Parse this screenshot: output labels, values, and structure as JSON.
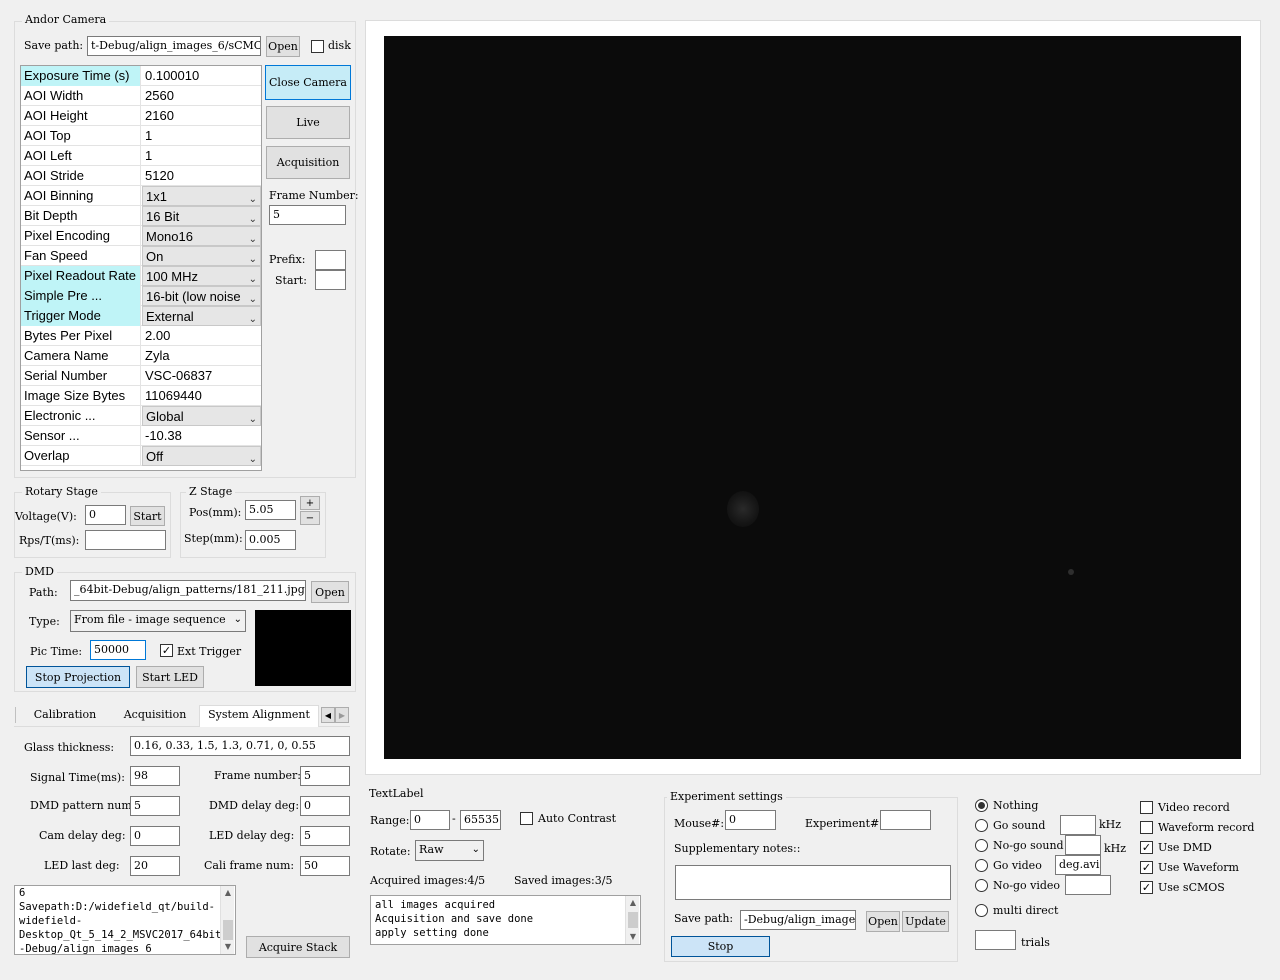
{
  "andor": {
    "group_title": "Andor Camera",
    "save_path_label": "Save path:",
    "save_path_value": "t-Debug/align_images_6/sCMOS",
    "open_label": "Open",
    "disk_label": "disk",
    "disk_checked": false,
    "properties": [
      {
        "name": "Exposure Time (s)",
        "value": "0.100010",
        "highlight": true,
        "combo": false
      },
      {
        "name": "AOI Width",
        "value": "2560",
        "highlight": false,
        "combo": false
      },
      {
        "name": "AOI Height",
        "value": "2160",
        "highlight": false,
        "combo": false
      },
      {
        "name": "AOI Top",
        "value": "1",
        "highlight": false,
        "combo": false
      },
      {
        "name": "AOI Left",
        "value": "1",
        "highlight": false,
        "combo": false
      },
      {
        "name": "AOI Stride",
        "value": "5120",
        "highlight": false,
        "combo": false
      },
      {
        "name": "AOI Binning",
        "value": "1x1",
        "highlight": false,
        "combo": true
      },
      {
        "name": "Bit Depth",
        "value": "16 Bit",
        "highlight": false,
        "combo": true
      },
      {
        "name": "Pixel Encoding",
        "value": "Mono16",
        "highlight": false,
        "combo": true
      },
      {
        "name": "Fan Speed",
        "value": "On",
        "highlight": false,
        "combo": true
      },
      {
        "name": "Pixel Readout Rate",
        "value": "100 MHz",
        "highlight": true,
        "combo": true
      },
      {
        "name": "Simple Pre ...",
        "value": "16-bit (low noise",
        "highlight": true,
        "combo": true
      },
      {
        "name": "Trigger Mode",
        "value": "External",
        "highlight": true,
        "combo": true
      },
      {
        "name": "Bytes Per Pixel",
        "value": "2.00",
        "highlight": false,
        "combo": false
      },
      {
        "name": "Camera Name",
        "value": "Zyla",
        "highlight": false,
        "combo": false
      },
      {
        "name": "Serial Number",
        "value": "VSC-06837",
        "highlight": false,
        "combo": false
      },
      {
        "name": "Image Size Bytes",
        "value": "11069440",
        "highlight": false,
        "combo": false
      },
      {
        "name": "Electronic ...",
        "value": "Global",
        "highlight": false,
        "combo": true
      },
      {
        "name": "Sensor ...",
        "value": "-10.38",
        "highlight": false,
        "combo": false
      },
      {
        "name": "Overlap",
        "value": "Off",
        "highlight": false,
        "combo": true
      }
    ],
    "close_camera": "Close Camera",
    "live": "Live",
    "acquisition": "Acquisition",
    "frame_number_label": "Frame Number:",
    "frame_number_value": "5",
    "prefix_label": "Prefix:",
    "prefix_value": "",
    "start_label": "Start:",
    "start_value": ""
  },
  "rotary": {
    "title": "Rotary Stage",
    "voltage_label": "Voltage(V):",
    "voltage_value": "0",
    "start_button": "Start",
    "rps_label": "Rps/T(ms):",
    "rps_value": ""
  },
  "zstage": {
    "title": "Z Stage",
    "pos_label": "Pos(mm):",
    "pos_value": "5.05",
    "plus": "+",
    "minus": "−",
    "step_label": "Step(mm):",
    "step_value": "0.005"
  },
  "dmd": {
    "title": "DMD",
    "path_label": "Path:",
    "path_value": "_64bit-Debug/align_patterns/181_211.jpg",
    "open_label": "Open",
    "type_label": "Type:",
    "type_value": "From file - image sequence",
    "pic_time_label": "Pic Time:",
    "pic_time_value": "50000",
    "ext_trigger_label": "Ext Trigger",
    "ext_trigger_checked": true,
    "stop_projection": "Stop Projection",
    "start_led": "Start LED"
  },
  "tabs": {
    "items": [
      "Calibration",
      "Acquisition",
      "System Alignment"
    ],
    "active_index": 2
  },
  "alignment": {
    "glass_label": "Glass thickness:",
    "glass_value": "0.16, 0.33, 1.5, 1.3, 0.71, 0, 0.55",
    "signal_time_label": "Signal Time(ms):",
    "signal_time_value": "98",
    "frame_number_label": "Frame number:",
    "frame_number_value": "5",
    "dmd_pattern_label": "DMD pattern num:",
    "dmd_pattern_value": "5",
    "dmd_delay_label": "DMD delay deg:",
    "dmd_delay_value": "0",
    "cam_delay_label": "Cam delay deg:",
    "cam_delay_value": "0",
    "led_delay_label": "LED delay deg:",
    "led_delay_value": "5",
    "led_last_label": "LED last deg:",
    "led_last_value": "20",
    "cali_frame_label": "Cali frame num:",
    "cali_frame_value": "50",
    "log_text": "6\nSavepath:D:/widefield_qt/build-\nwidefield-\nDesktop_Qt_5_14_2_MSVC2017_64bit\n-Debug/align_images_6",
    "acquire_stack": "Acquire Stack"
  },
  "display": {
    "text_label": "TextLabel",
    "range_label": "Range:",
    "range_min": "0",
    "range_dash": "-",
    "range_max": "65535",
    "auto_contrast_label": "Auto Contrast",
    "auto_contrast_checked": false,
    "rotate_label": "Rotate:",
    "rotate_value": "Raw",
    "acquired_label": "Acquired images:4/5",
    "saved_label": "Saved images:3/5",
    "log_text": "all images acquired\nAcquisition and save done\napply setting done"
  },
  "experiment": {
    "title": "Experiment settings",
    "mouse_label": "Mouse#:",
    "mouse_value": "0",
    "experiment_label": "Experiment#:",
    "experiment_value": "",
    "notes_label": "Supplementary notes::",
    "notes_value": "",
    "save_path_label": "Save path:",
    "save_path_value": "-Debug/align_images",
    "open_label": "Open",
    "update_label": "Update",
    "stop_label": "Stop"
  },
  "modes": {
    "radios": [
      {
        "label": "Nothing",
        "checked": true
      },
      {
        "label": "Go sound",
        "checked": false
      },
      {
        "label": "No-go sound",
        "checked": false
      },
      {
        "label": "Go video",
        "checked": false
      },
      {
        "label": "No-go video",
        "checked": false
      },
      {
        "label": "multi direct",
        "checked": false
      }
    ],
    "khz_label": "kHz",
    "go_video_file": "deg.avi",
    "trials_label": "trials",
    "trials_value": "",
    "checks": [
      {
        "label": "Video record",
        "checked": false
      },
      {
        "label": "Waveform record",
        "checked": false
      },
      {
        "label": "Use DMD",
        "checked": true
      },
      {
        "label": "Use Waveform",
        "checked": true
      },
      {
        "label": "Use sCMOS",
        "checked": true
      }
    ]
  }
}
